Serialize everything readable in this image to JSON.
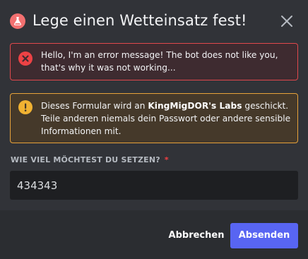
{
  "modal": {
    "title": "Lege einen Wetteinsatz fest!",
    "app_icon": "bot-app-icon",
    "close_icon": "close-icon"
  },
  "error_alert": {
    "icon": "error-x-icon",
    "text": "Hello, I'm an error message! The bot does not like you, that's why it was not working...",
    "color": "#ed4245"
  },
  "warning_alert": {
    "icon": "warning-exclamation-icon",
    "text_prefix": "Dieses Formular wird an ",
    "app_name": "KingMigDOR's Labs",
    "text_suffix": " geschickt. Teile anderen niemals dein Passwort oder andere sensible Informationen mit.",
    "color": "#f0b232"
  },
  "field": {
    "label": "WIE VIEL MÖCHTEST DU SETZEN?",
    "required_marker": "*",
    "value": "434343"
  },
  "footer": {
    "cancel_label": "Abbrechen",
    "submit_label": "Absenden",
    "submit_color": "#5865f2"
  }
}
